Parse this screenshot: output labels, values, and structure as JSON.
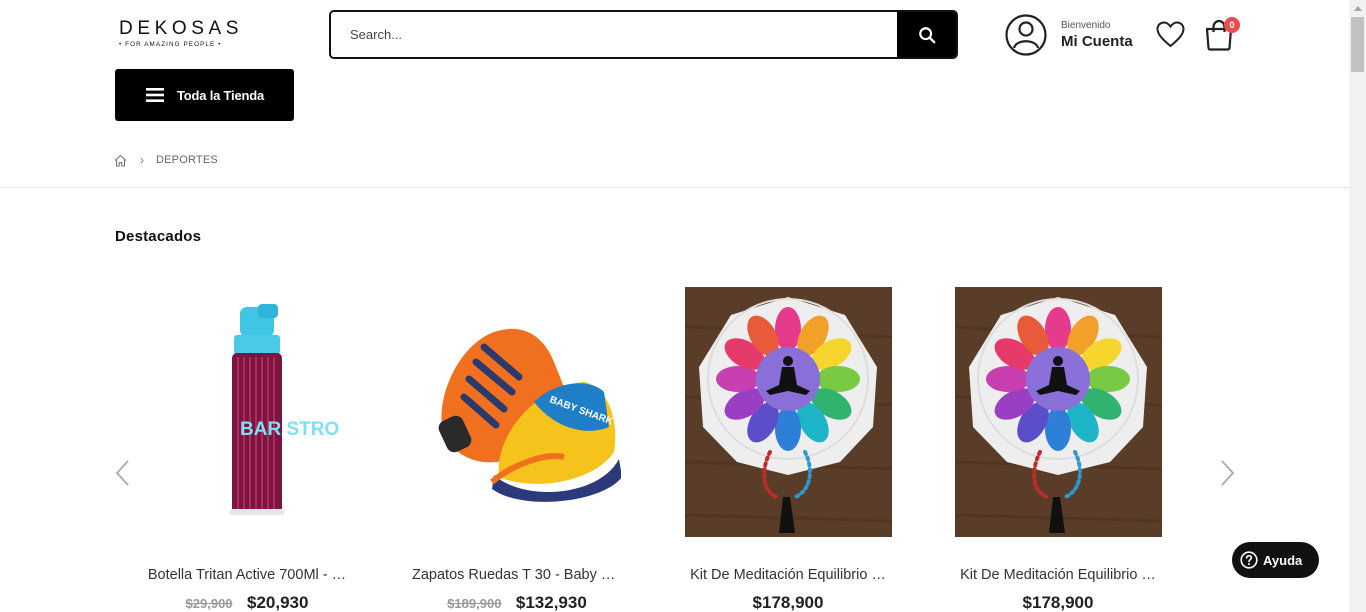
{
  "header": {
    "logo_main": "DEKOSAS",
    "logo_sub": "• FOR AMAZING PEOPLE •",
    "search_placeholder": "Search...",
    "account_welcome": "Bienvenido",
    "account_name": "Mi Cuenta",
    "cart_count": "0"
  },
  "menu": {
    "label": "Toda la Tienda"
  },
  "breadcrumb": {
    "current": "DEPORTES"
  },
  "section": {
    "title": "Destacados"
  },
  "products": [
    {
      "name": "Botella Tritan Active 700Ml - …",
      "old_price": "$29,900",
      "price": "$20,930"
    },
    {
      "name": "Zapatos Ruedas T 30 - Baby S…",
      "old_price": "$189,900",
      "price": "$132,930"
    },
    {
      "name": "Kit De Meditación Equilibrio …",
      "old_price": "",
      "price": "$178,900"
    },
    {
      "name": "Kit De Meditación Equilibrio …",
      "old_price": "",
      "price": "$178,900"
    }
  ],
  "bottle_text": "BAR STRO",
  "shoe_text": "BABY SHARK",
  "help": {
    "label": "Ayuda"
  },
  "colors": {
    "accent": "#000000",
    "badge": "#ee4d4d",
    "text": "#222222"
  }
}
